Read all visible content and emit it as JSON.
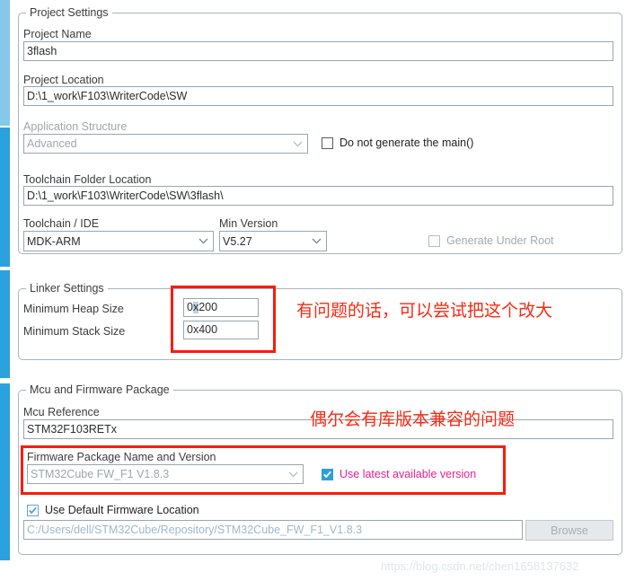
{
  "project_settings": {
    "title": "Project Settings",
    "project_name_label": "Project Name",
    "project_name_value": "3flash",
    "project_location_label": "Project Location",
    "project_location_value": "D:\\1_work\\F103\\WriterCode\\SW",
    "application_structure_label": "Application Structure",
    "application_structure_value": "Advanced",
    "do_not_generate_main_label": "Do not generate the main()",
    "toolchain_folder_label": "Toolchain Folder Location",
    "toolchain_folder_value": "D:\\1_work\\F103\\WriterCode\\SW\\3flash\\",
    "toolchain_ide_label": "Toolchain / IDE",
    "toolchain_ide_value": "MDK-ARM",
    "min_version_label": "Min Version",
    "min_version_value": "V5.27",
    "generate_under_root_label": "Generate Under Root"
  },
  "linker_settings": {
    "title": "Linker Settings",
    "heap_label": "Minimum Heap Size",
    "heap_value_pre": "0",
    "heap_value_sel": "x",
    "heap_value_post": "200",
    "stack_label": "Minimum Stack Size",
    "stack_value": "0x400",
    "annotation": "有问题的话，可以尝试把这个改大"
  },
  "mcu_firmware": {
    "title": "Mcu and Firmware Package",
    "mcu_reference_label": "Mcu Reference",
    "mcu_reference_value": "STM32F103RETx",
    "firmware_package_label": "Firmware Package Name and Version",
    "firmware_package_value": "STM32Cube FW_F1 V1.8.3",
    "use_latest_label": "Use latest available version",
    "use_default_location_label": "Use Default Firmware Location",
    "firmware_location_value": "C:/Users/dell/STM32Cube/Repository/STM32Cube_FW_F1_V1.8.3",
    "browse_label": "Browse",
    "annotation": "偶尔会有库版本兼容的问题"
  },
  "watermark": {
    "text": "https://blog.csdn.net/chen1658137632"
  },
  "colors": {
    "rail_top": "#86c8ea",
    "rail": "#2ba1dd",
    "annotation_red": "#f82a13",
    "redbox": "#f81c0a",
    "magenta": "#e8218a",
    "checkbox_blue": "#29a0dc"
  }
}
